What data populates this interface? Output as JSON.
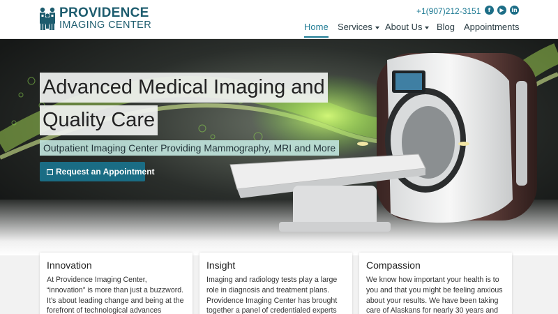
{
  "brand": {
    "line1": "PROVIDENCE",
    "line2": "IMAGING CENTER",
    "logo_icon": "family-logo-icon",
    "color": "#1d5c6e"
  },
  "contact": {
    "phone": "+1(907)212-3151",
    "social": [
      "facebook-icon",
      "youtube-icon",
      "linkedin-icon"
    ]
  },
  "nav": {
    "items": [
      {
        "label": "Home",
        "active": true
      },
      {
        "label": "Services",
        "dropdown": true
      },
      {
        "label": "About Us",
        "dropdown": true
      },
      {
        "label": "Blog"
      },
      {
        "label": "Appointments"
      }
    ]
  },
  "hero": {
    "title_line1": "Advanced Medical Imaging and",
    "title_line2": "Quality Care",
    "subtitle": "Outpatient Imaging Center Providing Mammography, MRI and More",
    "cta_label": "Request an Appointment",
    "cta_icon": "calendar-icon",
    "accent": "#1a6c84"
  },
  "cards": [
    {
      "title": "Innovation",
      "text": "At Providence Imaging Center, “innovation” is more than just a buzzword. It’s about leading change and being at the forefront of technological advances"
    },
    {
      "title": "Insight",
      "text": "Imaging and radiology tests play a large role in diagnosis and treatment plans. Providence Imaging Center has brought together a panel of credentialed experts"
    },
    {
      "title": "Compassion",
      "text": "We know how important your health is to you and that you might be feeling anxious about your results. We have been taking care of Alaskans for nearly 30 years and"
    }
  ]
}
